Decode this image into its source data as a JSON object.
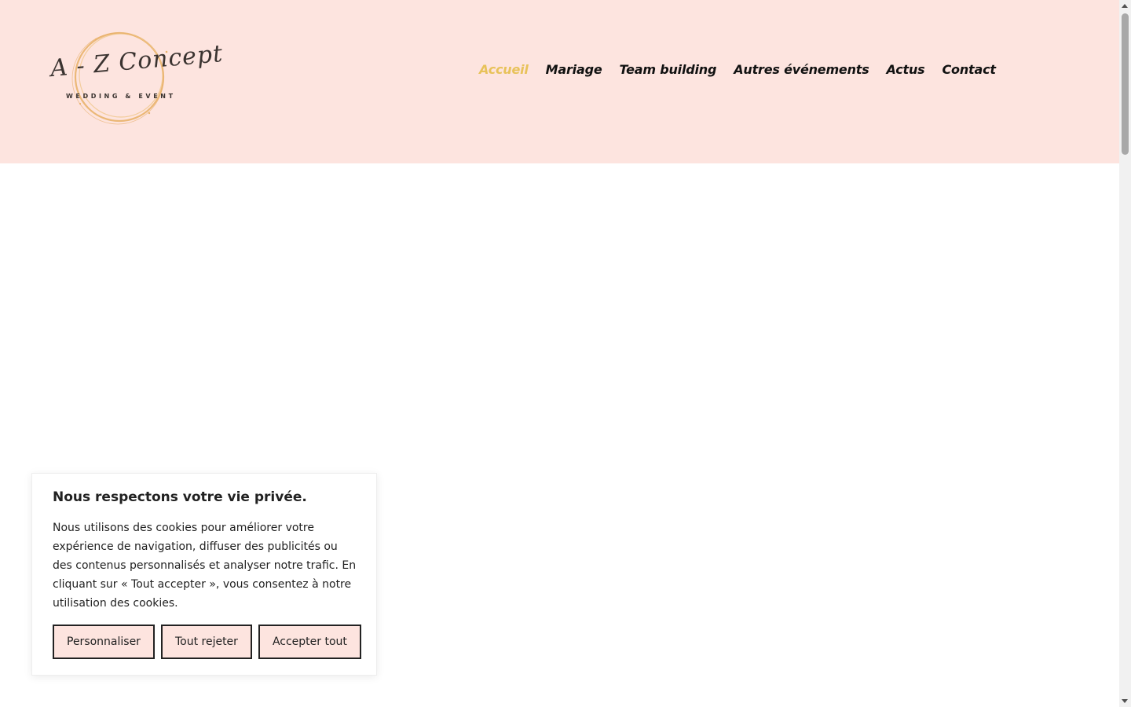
{
  "colors": {
    "header_bg": "#fde4df",
    "nav_active": "#e8c25a",
    "nav_text": "#111111",
    "logo_gold": "#e9b26b",
    "button_bg": "#fde4df",
    "button_border": "#222222"
  },
  "header": {
    "logo": {
      "wordmark": "A - Z Concept",
      "tagline": "WEDDING & EVENT"
    },
    "nav": [
      {
        "label": "Accueil",
        "active": true
      },
      {
        "label": "Mariage",
        "active": false
      },
      {
        "label": "Team building",
        "active": false
      },
      {
        "label": "Autres événements",
        "active": false
      },
      {
        "label": "Actus",
        "active": false
      },
      {
        "label": "Contact",
        "active": false
      }
    ]
  },
  "cookie_banner": {
    "title": "Nous respectons votre vie privée.",
    "text": "Nous utilisons des cookies pour améliorer votre expérience de navigation, diffuser des publicités ou des contenus personnalisés et analyser notre trafic. En cliquant sur « Tout accepter », vous consentez à notre utilisation des cookies.",
    "buttons": {
      "customize": "Personnaliser",
      "reject": "Tout rejeter",
      "accept": "Accepter tout"
    }
  },
  "icons": {
    "scroll_up": "chevron-up-icon",
    "scroll_down": "chevron-down-icon"
  }
}
